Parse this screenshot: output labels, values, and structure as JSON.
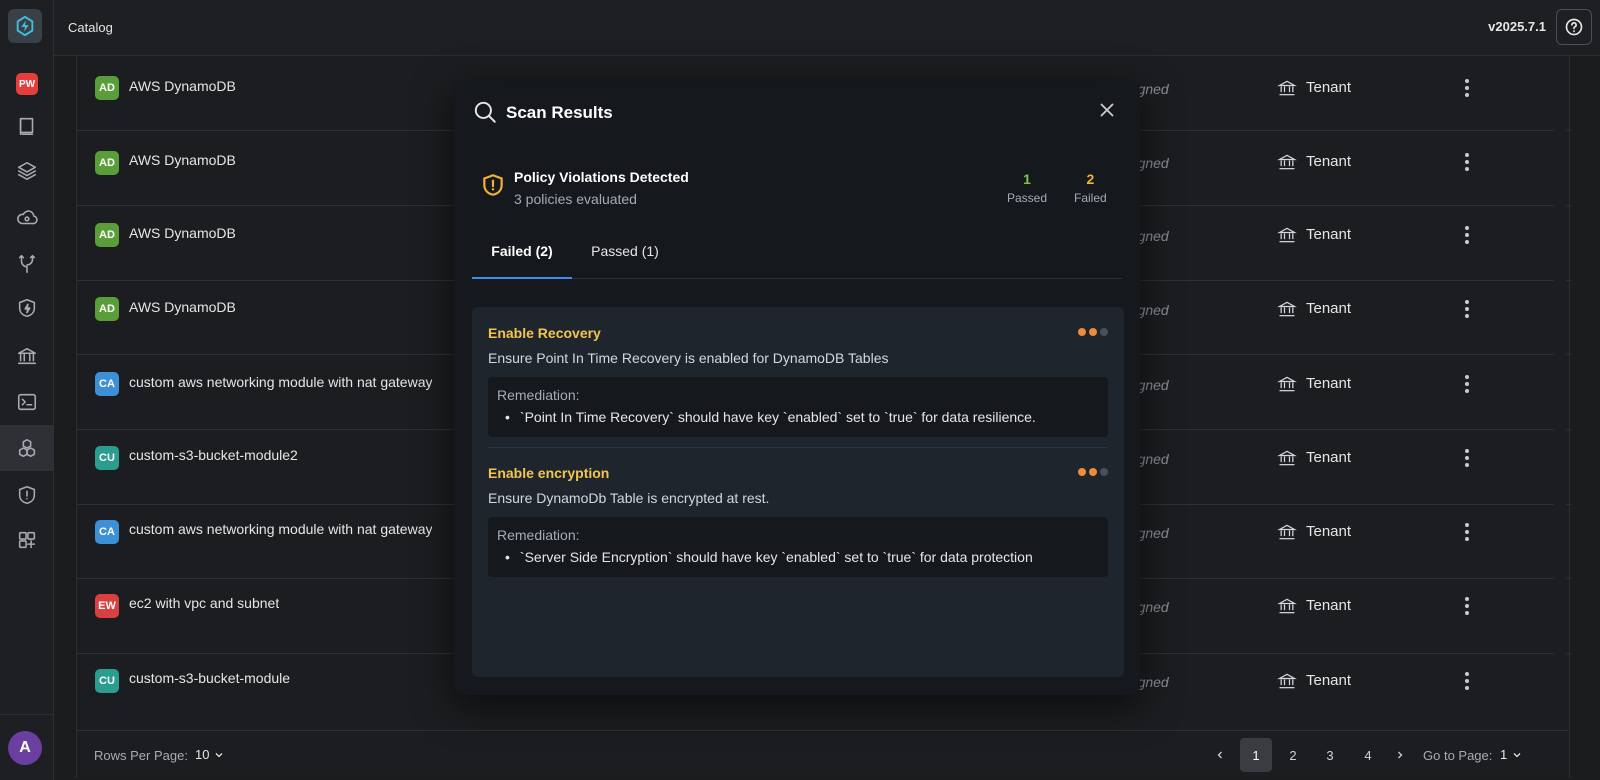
{
  "header": {
    "title": "Catalog",
    "version": "v2025.7.1"
  },
  "sidebar": {
    "workspace_badge": "PW",
    "user_initial": "A",
    "items": [
      "pw-badge",
      "book-icon",
      "layers-icon",
      "cloud-search-icon",
      "git-branch-icon",
      "shield-bolt-icon",
      "bank-icon",
      "terminal-icon",
      "modules-icon",
      "shield-alert-icon",
      "grid-plus-icon"
    ]
  },
  "table": {
    "rows": [
      {
        "initials": "AD",
        "name": "AWS DynamoDB",
        "color": "#5a9e3a",
        "assigned": "Not assigned",
        "tenant": "Tenant"
      },
      {
        "initials": "AD",
        "name": "AWS DynamoDB",
        "color": "#5a9e3a",
        "assigned": "Not assigned",
        "tenant": "Tenant"
      },
      {
        "initials": "AD",
        "name": "AWS DynamoDB",
        "color": "#5a9e3a",
        "assigned": "Not assigned",
        "tenant": "Tenant"
      },
      {
        "initials": "AD",
        "name": "AWS DynamoDB",
        "color": "#5a9e3a",
        "assigned": "Not assigned",
        "tenant": "Tenant"
      },
      {
        "initials": "CA",
        "name": "custom aws networking module with nat gateway",
        "color": "#3d8fd6",
        "assigned": "Not assigned",
        "tenant": "Tenant"
      },
      {
        "initials": "CU",
        "name": "custom-s3-bucket-module2",
        "color": "#2a9d8f",
        "assigned": "Not assigned",
        "tenant": "Tenant"
      },
      {
        "initials": "CA",
        "name": "custom aws networking module with nat gateway",
        "color": "#3d8fd6",
        "assigned": "Not assigned",
        "tenant": "Tenant"
      },
      {
        "initials": "EW",
        "name": "ec2 with vpc and subnet",
        "color": "#d94040",
        "assigned": "Not assigned",
        "tenant": "Tenant"
      },
      {
        "initials": "CU",
        "name": "custom-s3-bucket-module",
        "color": "#2a9d8f",
        "assigned": "Not assigned",
        "tenant": "Tenant"
      }
    ]
  },
  "footer": {
    "rows_per_page_label": "Rows Per Page:",
    "rows_per_page_value": "10",
    "pages": [
      "1",
      "2",
      "3",
      "4"
    ],
    "current_page": "1",
    "goto_label": "Go to Page:",
    "goto_value": "1"
  },
  "modal": {
    "title": "Scan Results",
    "summary_title": "Policy Violations Detected",
    "summary_sub": "3 policies evaluated",
    "passed_count": "1",
    "passed_label": "Passed",
    "failed_count": "2",
    "failed_label": "Failed",
    "passed_color": "#7bc94a",
    "failed_color": "#f3b52e",
    "tabs": [
      {
        "label": "Failed (2)",
        "active": true
      },
      {
        "label": "Passed (1)",
        "active": false
      }
    ],
    "violations": [
      {
        "title": "Enable Recovery",
        "description": "Ensure Point In Time Recovery is enabled for DynamoDB Tables",
        "remediation_label": "Remediation:",
        "remediation": "`Point In Time Recovery` should have key `enabled` set to `true` for data resilience."
      },
      {
        "title": "Enable encryption",
        "description": "Ensure DynamoDb Table is encrypted at rest.",
        "remediation_label": "Remediation:",
        "remediation": "`Server Side Encryption` should have key `enabled` set to `true` for data protection"
      }
    ]
  }
}
